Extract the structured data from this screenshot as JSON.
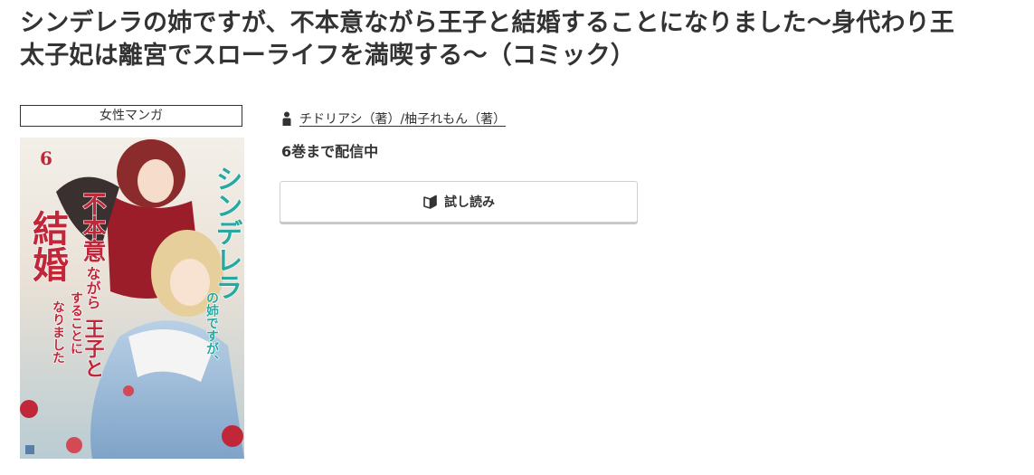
{
  "title": "シンデレラの姉ですが、不本意ながら王子と結婚することになりました〜身代わり王太子妃は離宮でスローライフを満喫する〜（コミック）",
  "genre": "女性マンガ",
  "authors": "チドリアシ（著）/柚子れもん（著）",
  "status": "6巻まで配信中",
  "trial_button": {
    "label": "試し読み",
    "icon": "open-book-icon"
  },
  "cover": {
    "volume": "6",
    "title_lines": [
      "シンデレラ",
      "の姉ですが、",
      "不本意",
      "ながら",
      "王子と",
      "結婚",
      "することに",
      "なりました"
    ],
    "colors": {
      "accent_teal": "#2aa7a0",
      "accent_red": "#c0283a",
      "dress_blue": "#8fb2d6",
      "dress_red": "#9c1d2a"
    }
  },
  "icons": {
    "author": "person-icon"
  }
}
